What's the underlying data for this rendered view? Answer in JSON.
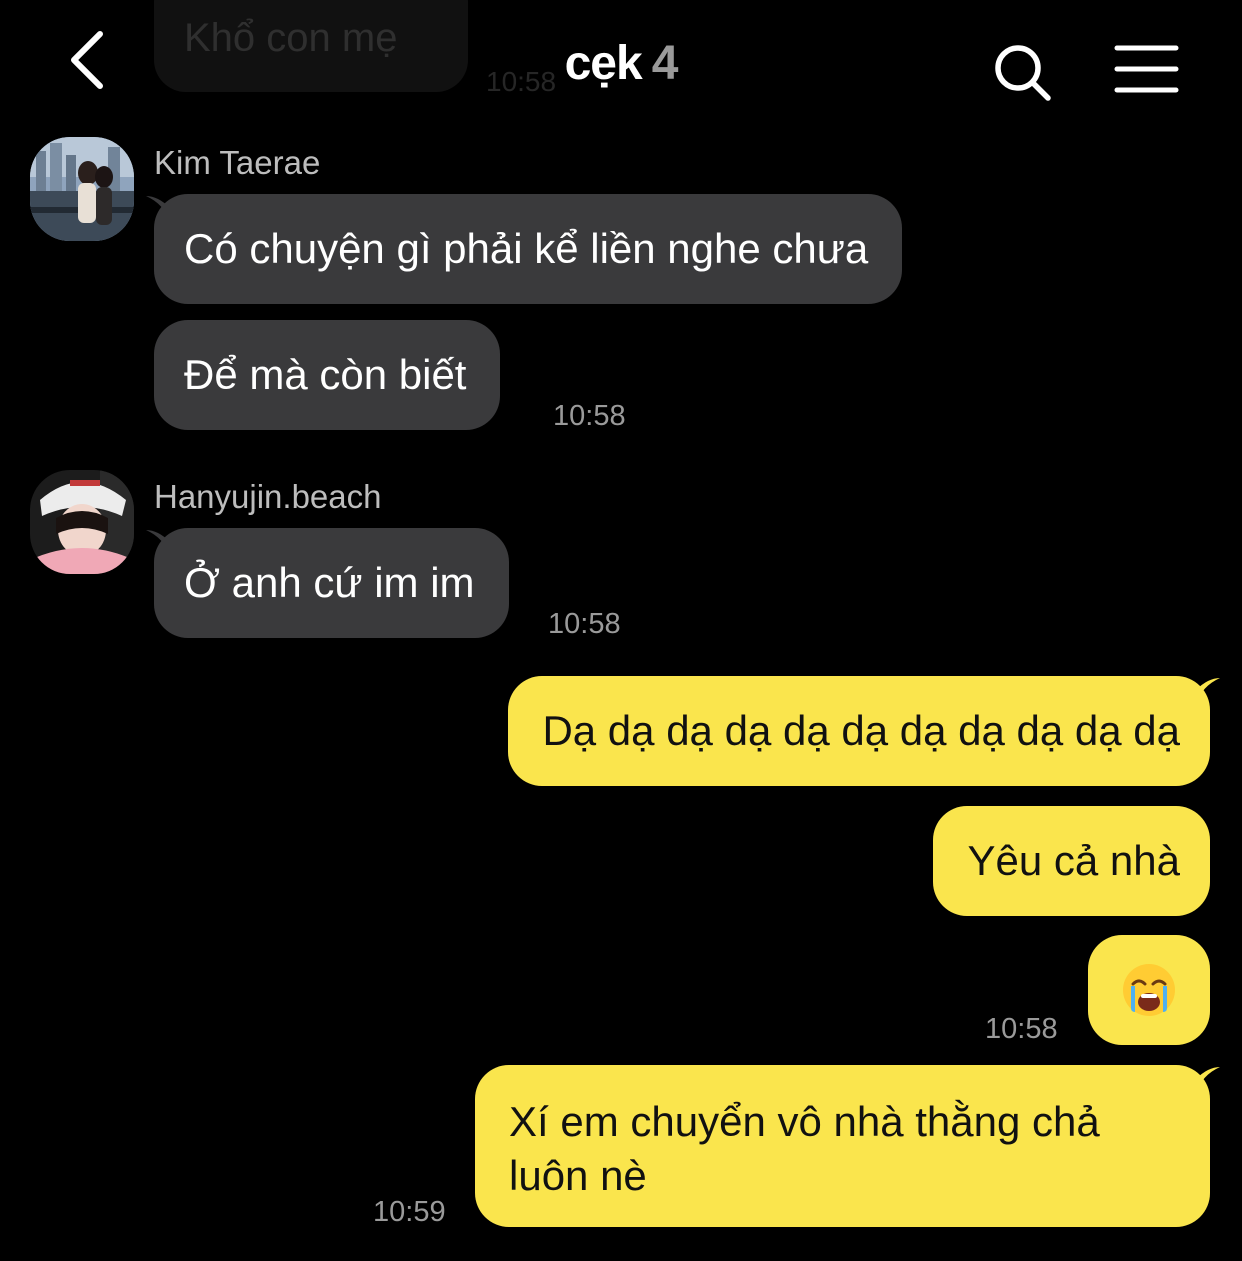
{
  "header": {
    "title": "cẹk",
    "member_count": "4",
    "back_icon": "chevron-left-icon",
    "search_icon": "search-icon",
    "menu_icon": "hamburger-menu-icon"
  },
  "previous": {
    "text": "Khổ con mẹ",
    "time": "10:58"
  },
  "groups": [
    {
      "sender": "Kim Taerae",
      "messages": [
        "Có chuyện gì phải kể liền nghe chưa",
        "Để mà còn biết"
      ],
      "time": "10:58"
    },
    {
      "sender": "Hanyujin.beach",
      "messages": [
        "Ở anh cứ im im"
      ],
      "time": "10:58"
    }
  ],
  "outgoing": {
    "messages": [
      "Dạ dạ dạ dạ dạ dạ dạ dạ dạ dạ dạ",
      "Yêu cả nhà"
    ],
    "emoji": "loudly-crying-face-emoji",
    "time_1": "10:58",
    "last_message": "Xí em chuyển vô nhà thằng chả luôn nè",
    "time_2": "10:59"
  },
  "colors": {
    "background": "#000000",
    "incoming_bubble": "#3a3a3c",
    "outgoing_bubble": "#fae54d",
    "timestamp": "#9a9a9a"
  }
}
